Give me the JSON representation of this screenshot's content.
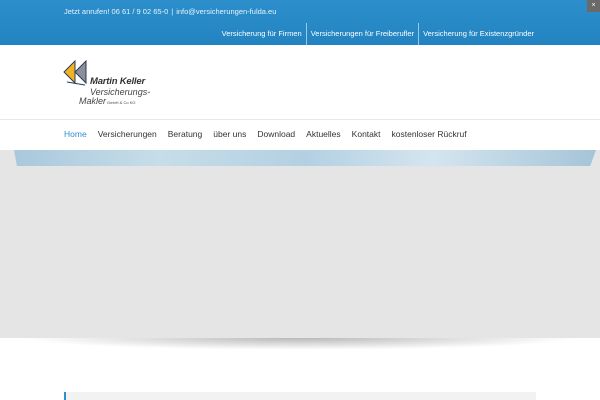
{
  "topbar": {
    "call_label": "Jetzt anrufen! 06 61 / 9 02 65-0",
    "separator": "|",
    "email": "info@versicherungen-fulda.eu",
    "corner_icon": "×",
    "links": [
      "Versicherung für Firmen",
      "Versicherungen für Freiberufler",
      "Versicherung für Existenzgründer"
    ]
  },
  "logo": {
    "name": "Martin Keller",
    "line2": "Versicherungs-",
    "line3": "Makler",
    "suffix": "GmbH & Co KG",
    "colors": {
      "yellow": "#f0b323",
      "navy": "#2b3a55",
      "gray": "#8a8f99"
    }
  },
  "nav": {
    "items": [
      "Home",
      "Versicherungen",
      "Beratung",
      "über uns",
      "Download",
      "Aktuelles",
      "Kontakt",
      "kostenloser Rückruf"
    ],
    "active_index": 0,
    "active_color": "#2e8fcf"
  }
}
